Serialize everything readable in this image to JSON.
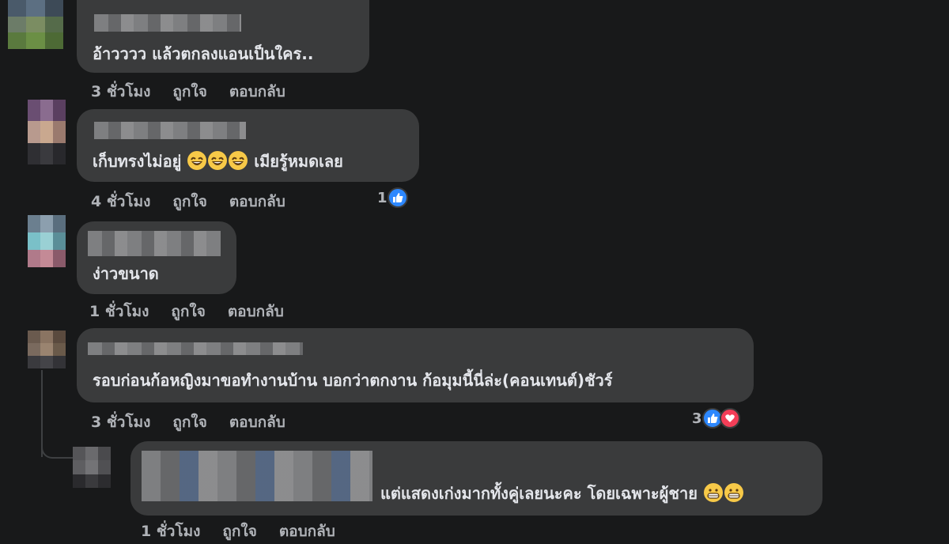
{
  "comments": [
    {
      "text": "อ้าวววว แล้วตกลงแอนเป็นใคร..",
      "time": "3 ชั่วโมง",
      "like": "ถูกใจ",
      "reply": "ตอบกลับ"
    },
    {
      "text_a": "เก็บทรงไม่อยู่",
      "text_b": "เมียรู้หมดเลย",
      "time": "4 ชั่วโมง",
      "like": "ถูกใจ",
      "reply": "ตอบกลับ",
      "reaction_count": "1"
    },
    {
      "text": "ง่าวขนาด",
      "time": "1 ชั่วโมง",
      "like": "ถูกใจ",
      "reply": "ตอบกลับ"
    },
    {
      "text": "รอบก่อนก้อหญิงมาขอทำงานบ้าน บอกว่าตกงาน ก้อมุมนี้นี่ล่ะ(คอนเทนต์)ชัวร์",
      "time": "3 ชั่วโมง",
      "like": "ถูกใจ",
      "reply": "ตอบกลับ",
      "reaction_count": "3"
    },
    {
      "text": "แต่แสดงเก่งมากทั้งคู่เลยนะคะ โดยเฉพาะผู้ชาย",
      "time": "1 ชั่วโมง",
      "like": "ถูกใจ",
      "reply": "ตอบกลับ"
    }
  ],
  "colors": {
    "background": "#18191a",
    "bubble": "#3a3b3c",
    "like_blue": "#2d88ff",
    "heart_red": "#f33e58"
  },
  "icons": [
    "laughing-emoji",
    "like-icon",
    "heart-icon",
    "grinning-emoji"
  ]
}
